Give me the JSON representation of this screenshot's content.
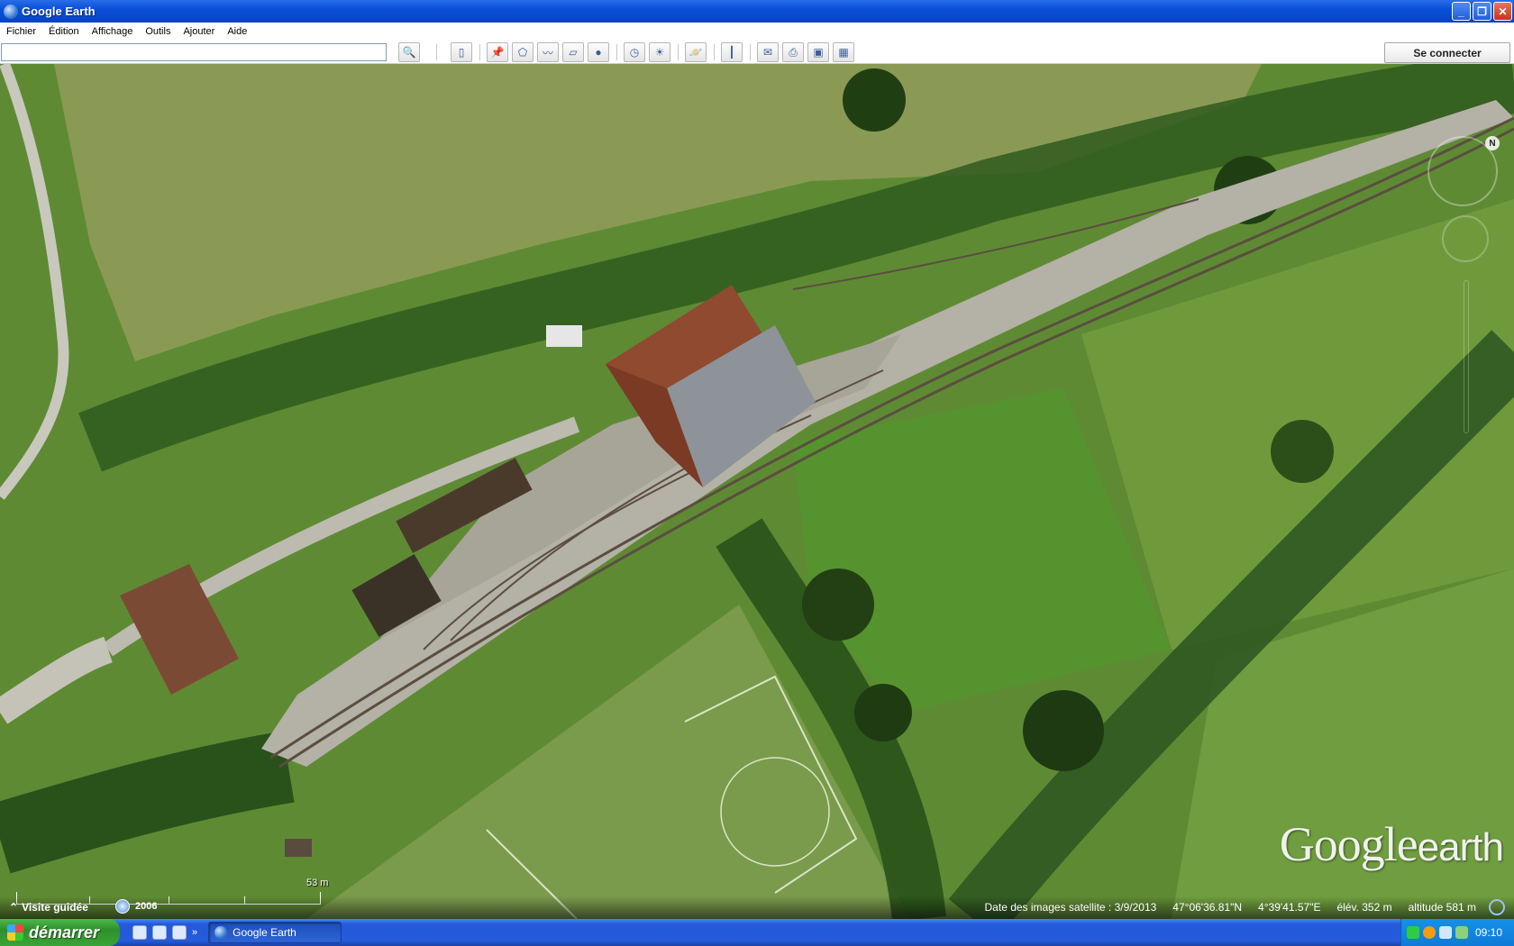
{
  "window": {
    "title": "Google Earth"
  },
  "menu": [
    "Fichier",
    "Édition",
    "Affichage",
    "Outils",
    "Ajouter",
    "Aide"
  ],
  "toolbar": {
    "search_value": "",
    "signin_label": "Se connecter",
    "buttons": [
      "search-icon",
      "sidebar-icon",
      "placemark-icon",
      "polygon-icon",
      "path-icon",
      "overlay-icon",
      "record-tour-icon",
      "historical-imagery-icon",
      "sunlight-icon",
      "planet-icon",
      "ruler-icon",
      "email-icon",
      "print-icon",
      "save-image-icon",
      "view-in-maps-icon"
    ]
  },
  "map": {
    "scale_label": "53  m",
    "logo_google": "Google",
    "logo_earth": "earth",
    "compass_label": "N"
  },
  "status": {
    "tour_label": "Visite guidée",
    "history_year": "2006",
    "imagery_date": "Date des images satellite : 3/9/2013",
    "latitude": "47°06'36.81\"N",
    "longitude": "4°39'41.57\"E",
    "elevation": "élév.  352 m",
    "altitude": "altitude    581 m"
  },
  "taskbar": {
    "start_label": "démarrer",
    "task_label": "Google Earth",
    "clock": "09:10"
  }
}
